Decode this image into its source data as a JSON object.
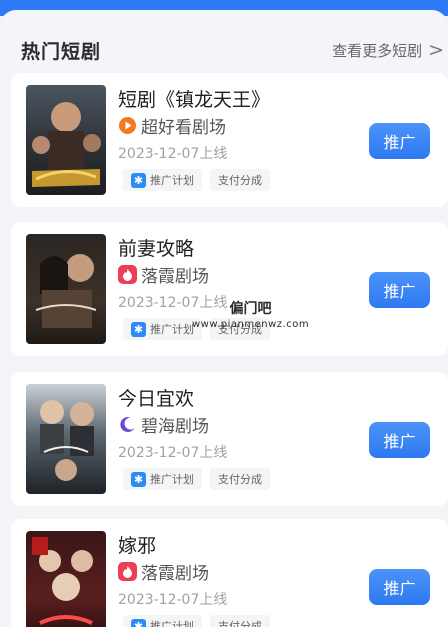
{
  "section": {
    "title": "热门短剧",
    "more_label": "查看更多短剧",
    "more_arrow": ">"
  },
  "cards": [
    {
      "title": "短剧《镇龙天王》",
      "theater": "超好看剧场",
      "theater_icon": "play-circle-icon",
      "date": "2023-12-07上线",
      "tags": [
        "推广计划",
        "支付分成"
      ],
      "button": "推广"
    },
    {
      "title": "前妻攻略",
      "theater": "落霞剧场",
      "theater_icon": "flame-icon",
      "date": "2023-12-07上线",
      "tags": [
        "推广计划",
        "支付分成"
      ],
      "button": "推广"
    },
    {
      "title": "今日宜欢",
      "theater": "碧海剧场",
      "theater_icon": "crescent-moon-icon",
      "date": "2023-12-07上线",
      "tags": [
        "推广计划",
        "支付分成"
      ],
      "button": "推广"
    },
    {
      "title": "嫁邪",
      "theater": "落霞剧场",
      "theater_icon": "flame-icon",
      "date": "2023-12-07上线",
      "tags": [
        "推广计划",
        "支付分成"
      ],
      "button": "推广"
    }
  ],
  "watermark": {
    "name": "偏门吧",
    "url": "www.pianmenwz.com"
  },
  "colors": {
    "accent": "#2d79f2",
    "header_band": "#2f7bf6",
    "theater_orange": "#f07a22",
    "theater_red": "#ee3e55",
    "theater_purple": "#6b4bd6"
  }
}
